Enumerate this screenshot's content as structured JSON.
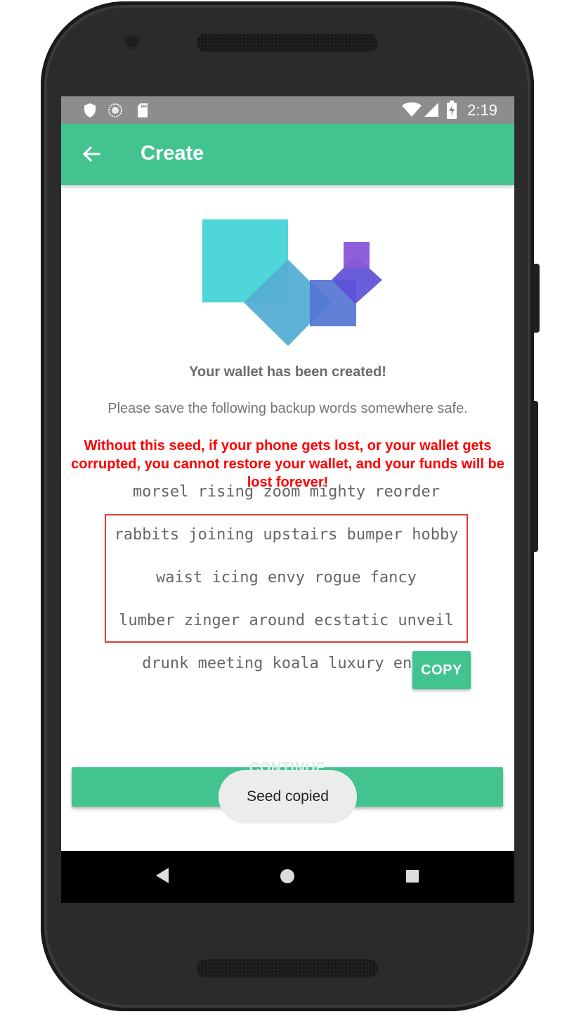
{
  "status_bar": {
    "time": "2:19",
    "left_icons": [
      "shield-icon",
      "sync-circle-icon",
      "sd-card-icon"
    ],
    "right_icons": [
      "wifi-icon",
      "cell-signal-icon",
      "battery-charging-icon"
    ]
  },
  "app_bar": {
    "title": "Create",
    "back_icon": "arrow-back-icon",
    "color": "#42c390"
  },
  "content": {
    "created_title": "Your wallet has been created!",
    "save_instruction": "Please save the following backup words somewhere safe.",
    "warning": "Without this seed, if your phone gets lost, or your wallet gets corrupted, you cannot restore your wallet, and your funds will be lost forever!",
    "warning_color": "#ff0000",
    "seed_lines": [
      "morsel rising zoom mighty reorder",
      "rabbits joining upstairs bumper hobby",
      "waist icing envy rogue fancy",
      "lumber zinger around ecstatic unveil",
      "drunk meeting koala luxury envy"
    ],
    "copy_label": "COPY",
    "continue_label": "CONTINUE"
  },
  "toast": {
    "message": "Seed copied"
  },
  "nav_bar": {
    "icons": [
      "back-triangle-icon",
      "home-circle-icon",
      "recents-square-icon"
    ]
  }
}
